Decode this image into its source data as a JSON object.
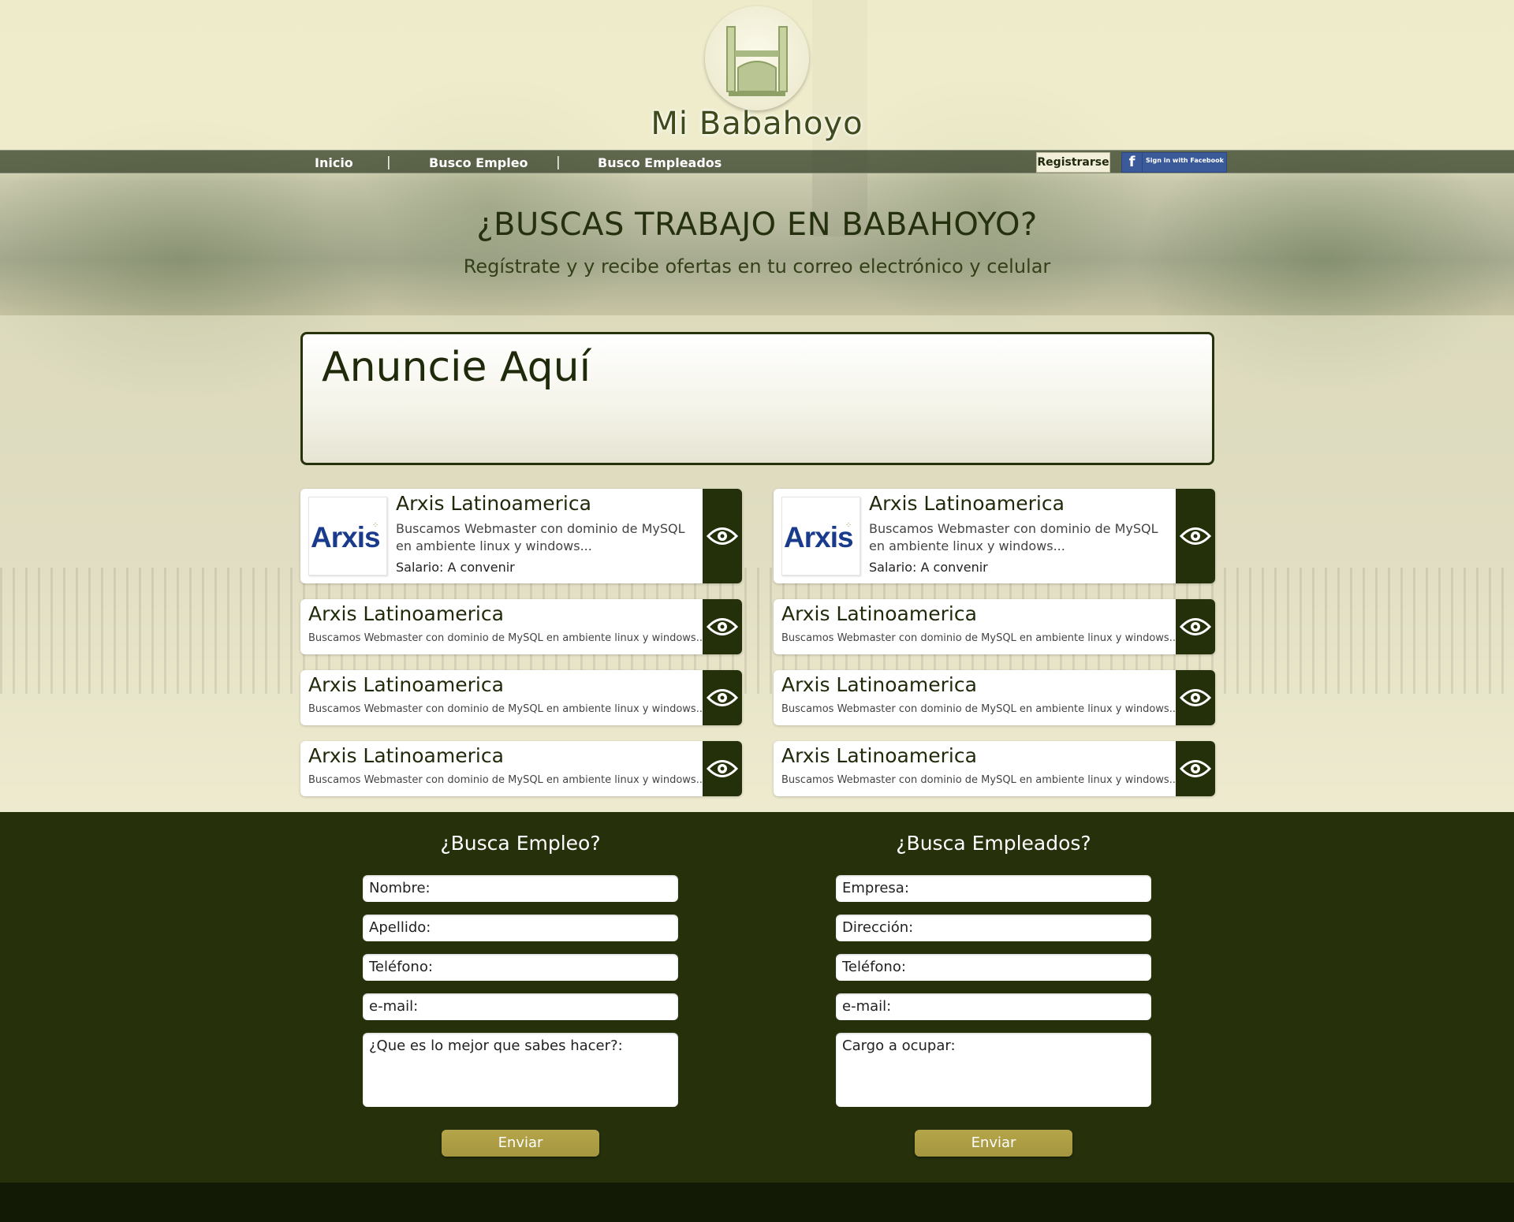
{
  "brand": {
    "name": "Mi Babahoyo"
  },
  "nav": {
    "items": [
      "Inicio",
      "Busco Empleo",
      "Busco Empleados"
    ],
    "separator": "|",
    "register_label": "Registrarse",
    "facebook_label": "Sign in with Facebook",
    "facebook_glyph": "f"
  },
  "hero": {
    "title": "¿BUSCAS TRABAJO EN BABAHOYO?",
    "subtitle": "Regístrate y y recibe ofertas en tu correo electrónico y celular"
  },
  "ad": {
    "title": "Anuncie Aquí"
  },
  "jobs": {
    "featured": [
      {
        "company": "Arxis Latinoamerica",
        "logo_text": "Arxis",
        "description": "Buscamos Webmaster con dominio de MySQL en ambiente linux y windows...",
        "salary": "Salario: A convenir"
      },
      {
        "company": "Arxis Latinoamerica",
        "logo_text": "Arxis",
        "description": "Buscamos Webmaster con dominio de MySQL en ambiente linux y windows...",
        "salary": "Salario: A convenir"
      }
    ],
    "list": [
      {
        "company": "Arxis Latinoamerica",
        "description": "Buscamos Webmaster con dominio de MySQL en ambiente linux y windows..."
      },
      {
        "company": "Arxis Latinoamerica",
        "description": "Buscamos Webmaster con dominio de MySQL en ambiente linux y windows..."
      },
      {
        "company": "Arxis Latinoamerica",
        "description": "Buscamos Webmaster con dominio de MySQL en ambiente linux y windows..."
      },
      {
        "company": "Arxis Latinoamerica",
        "description": "Buscamos Webmaster con dominio de MySQL en ambiente linux y windows..."
      },
      {
        "company": "Arxis Latinoamerica",
        "description": "Buscamos Webmaster con dominio de MySQL en ambiente linux y windows..."
      },
      {
        "company": "Arxis Latinoamerica",
        "description": "Buscamos Webmaster con dominio de MySQL en ambiente linux y windows..."
      }
    ],
    "view_icon": "eye-icon"
  },
  "forms": {
    "employee": {
      "title": "¿Busca Empleo?",
      "fields": [
        "Nombre:",
        "Apellido:",
        "Teléfono:",
        "e-mail:"
      ],
      "textarea": "¿Que es lo mejor que sabes hacer?:",
      "submit": "Enviar"
    },
    "employer": {
      "title": "¿Busca Empleados?",
      "fields": [
        "Empresa:",
        "Dirección:",
        "Teléfono:",
        "e-mail:"
      ],
      "textarea": "Cargo a ocupar:",
      "submit": "Enviar"
    }
  },
  "colors": {
    "accent_dark": "#243009",
    "button_gold": "#ab9c44",
    "facebook_blue": "#3b5a99",
    "page_bg": "#efeccc"
  }
}
